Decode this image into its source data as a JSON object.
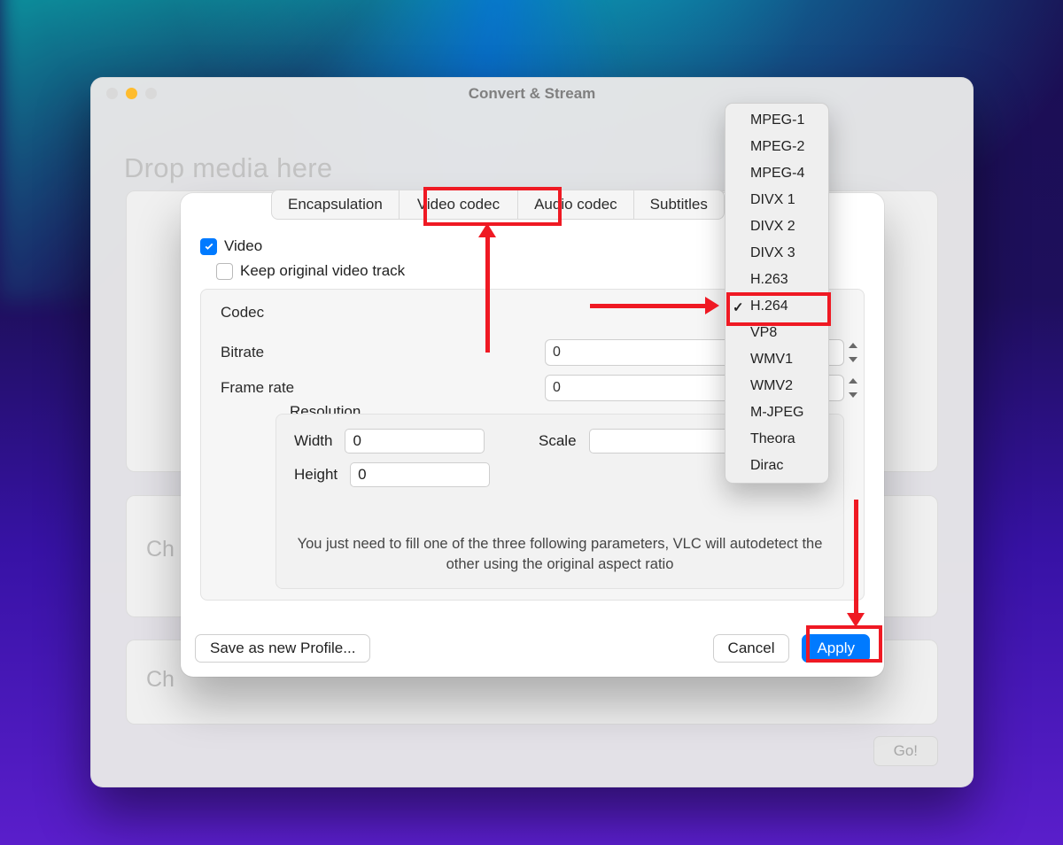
{
  "window": {
    "title": "Convert & Stream",
    "drop_hint": "Drop media here",
    "go_label": "Go!",
    "side_hint_b": "Ch",
    "side_hint_c": "Ch"
  },
  "tabs": {
    "encapsulation": "Encapsulation",
    "video_codec": "Video codec",
    "audio_codec": "Audio codec",
    "subtitles": "Subtitles"
  },
  "video_panel": {
    "video_checkbox_label": "Video",
    "video_checked": true,
    "keep_checkbox_label": "Keep original video track",
    "keep_checked": false,
    "codec_label": "Codec",
    "bitrate_label": "Bitrate",
    "bitrate_value": "0",
    "framerate_label": "Frame rate",
    "framerate_value": "0",
    "resolution_label": "Resolution",
    "width_label": "Width",
    "width_value": "0",
    "height_label": "Height",
    "height_value": "0",
    "scale_label": "Scale",
    "scale_value": "",
    "hint": "You just need to fill one of the three following parameters, VLC will autodetect the other using the original aspect ratio"
  },
  "codec_menu": {
    "selected": "H.264",
    "items": [
      "MPEG-1",
      "MPEG-2",
      "MPEG-4",
      "DIVX 1",
      "DIVX 2",
      "DIVX 3",
      "H.263",
      "H.264",
      "VP8",
      "WMV1",
      "WMV2",
      "M-JPEG",
      "Theora",
      "Dirac"
    ]
  },
  "buttons": {
    "save_profile": "Save as new Profile...",
    "cancel": "Cancel",
    "apply": "Apply"
  }
}
